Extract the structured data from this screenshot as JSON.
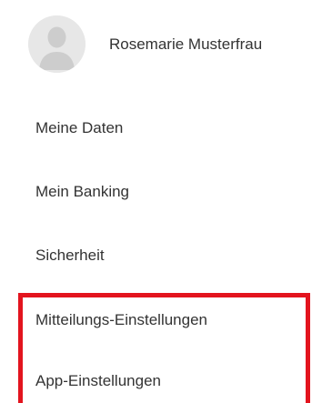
{
  "profile": {
    "avatar_icon": "user-avatar-placeholder-icon",
    "name": "Rosemarie Musterfrau"
  },
  "menu": {
    "items": [
      {
        "label": "Meine Daten"
      },
      {
        "label": "Mein Banking"
      },
      {
        "label": "Sicherheit"
      },
      {
        "label": "Mitteilungs-Einstellungen"
      },
      {
        "label": "App-Einstellungen"
      }
    ]
  },
  "highlight": {
    "color": "#e3141e"
  }
}
